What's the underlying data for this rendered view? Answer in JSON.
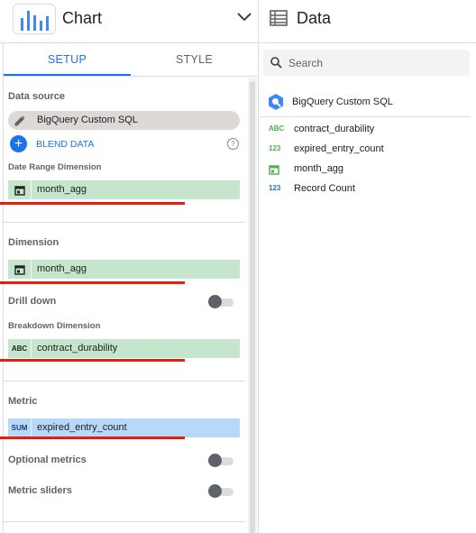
{
  "chart_panel": {
    "title": "Chart",
    "tabs": [
      {
        "label": "SETUP",
        "active": true
      },
      {
        "label": "STYLE",
        "active": false
      }
    ],
    "data_source": {
      "label": "Data source",
      "name": "BigQuery Custom SQL",
      "blend_label": "BLEND DATA",
      "help_glyph": "?"
    },
    "date_range": {
      "label": "Date Range Dimension",
      "field": "month_agg",
      "icon": "calendar-icon"
    },
    "dimension": {
      "label": "Dimension",
      "field": "month_agg",
      "icon": "calendar-icon"
    },
    "drill_down": {
      "label": "Drill down",
      "enabled": false
    },
    "breakdown": {
      "label": "Breakdown Dimension",
      "field": "contract_durability",
      "type_badge": "ABC"
    },
    "metric": {
      "label": "Metric",
      "aggregation": "SUM",
      "field": "expired_entry_count"
    },
    "optional_metrics": {
      "label": "Optional metrics",
      "enabled": false
    },
    "metric_sliders": {
      "label": "Metric sliders",
      "enabled": false
    }
  },
  "data_panel": {
    "title": "Data",
    "search_placeholder": "Search",
    "source_name": "BigQuery Custom SQL",
    "fields": [
      {
        "type_badge": "ABC",
        "name": "contract_durability",
        "kind": "text"
      },
      {
        "type_badge": "123",
        "name": "expired_entry_count",
        "kind": "number"
      },
      {
        "type_badge": "",
        "name": "month_agg",
        "kind": "date"
      },
      {
        "type_badge": "123",
        "name": "Record Count",
        "kind": "record"
      }
    ]
  },
  "colors": {
    "accent": "#1a73e8",
    "dimension_chip": "#c5e5cc",
    "metric_chip": "#b7d8f9",
    "annotation_red": "#ea1c0a"
  }
}
